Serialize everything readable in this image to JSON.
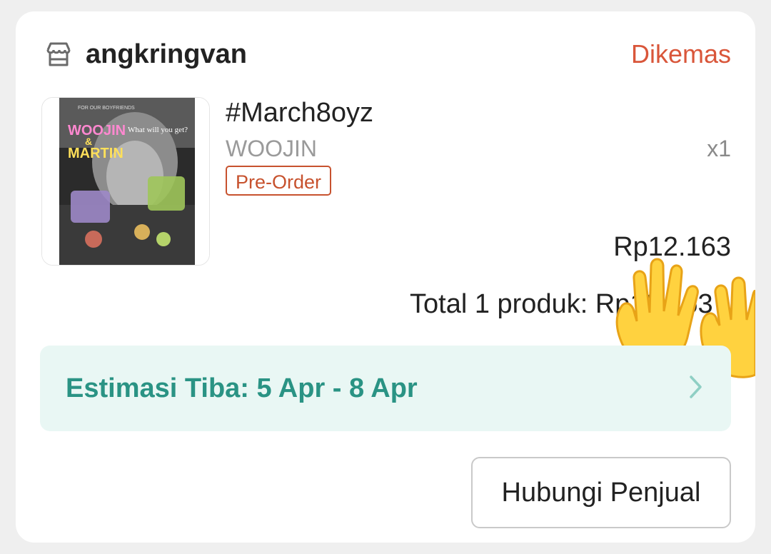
{
  "shop": {
    "name": "angkringvan",
    "icon": "store-icon",
    "status": "Dikemas",
    "status_color": "#d9563a"
  },
  "product": {
    "name": "#March8oyz",
    "variant": "WOOJIN",
    "quantity": "x1",
    "badge": "Pre-Order",
    "price": "Rp12.163",
    "image_text": {
      "top": "FOR OUR BOYFRIENDS",
      "title_1": "WOOJIN",
      "title_2": "&",
      "title_3": "MARTIN",
      "tagline": "What will you get?"
    }
  },
  "summary": {
    "total_label": "Total 1 produk:",
    "total_value": "Rp12.163"
  },
  "overlay": {
    "icon": "raised-hands-emoji-icon"
  },
  "eta": {
    "text": "Estimasi Tiba: 5 Apr - 8 Apr",
    "color": "#2a9384",
    "icon": "chevron-right-icon"
  },
  "actions": {
    "contact_label": "Hubungi Penjual"
  }
}
